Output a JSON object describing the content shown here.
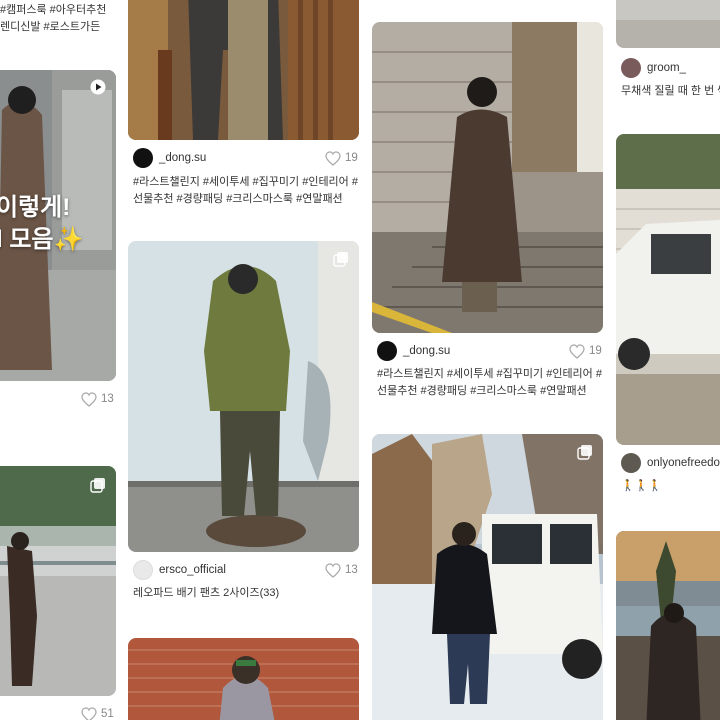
{
  "feed": {
    "col1": {
      "top_caption": [
        "#캠퍼스룩 #아우터추천",
        "렌디신발 #로스트가든"
      ],
      "card1": {
        "overlay": [
          "이렇게!",
          "l 모음✨"
        ],
        "likes": "13"
      },
      "card2": {
        "likes": "51"
      }
    },
    "col2": {
      "card1": {
        "author": "_dong.su",
        "likes": "19",
        "caption": [
          "#라스트챌린지 #세이투세 #집꾸미기 #인테리어 #",
          "선물추천 #경량패딩 #크리스마스룩 #연말패션"
        ]
      },
      "card2": {
        "author": "ersco_official",
        "likes": "13",
        "caption": [
          "레오파드 배기 팬츠 2사이즈(33)"
        ]
      }
    },
    "col3": {
      "card1": {
        "author": "_dong.su",
        "likes": "19",
        "caption": [
          "#라스트챌린지 #세이투세 #집꾸미기 #인테리어 #",
          "선물추천 #경량패딩 #크리스마스룩 #연말패션"
        ]
      }
    },
    "col4": {
      "card1": {
        "author": "groom_",
        "caption": [
          "무채색 질릴 때 한 번 씩"
        ]
      },
      "card2": {
        "author": "onlyonefreedo",
        "caption": [
          "🚶🚶🚶"
        ]
      }
    }
  },
  "icons": {
    "like": "heart-outline-icon",
    "multi": "multi-image-icon",
    "video": "play-icon"
  },
  "colors": {
    "text": "#222222",
    "muted": "#888888",
    "avatar_dark": "#111111"
  }
}
